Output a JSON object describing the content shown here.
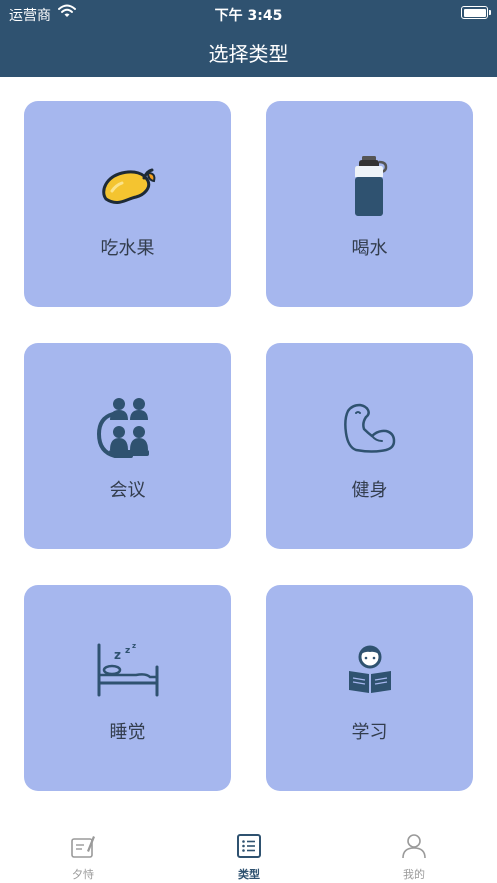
{
  "status_bar": {
    "carrier": "运营商",
    "time": "下午 3:45",
    "wifi_icon": "wifi-icon",
    "battery_icon": "battery-icon"
  },
  "nav": {
    "title": "选择类型"
  },
  "categories": [
    {
      "label": "吃水果",
      "icon": "mango-icon"
    },
    {
      "label": "喝水",
      "icon": "water-bottle-icon"
    },
    {
      "label": "会议",
      "icon": "meeting-people-icon"
    },
    {
      "label": "健身",
      "icon": "flexed-arm-icon"
    },
    {
      "label": "睡觉",
      "icon": "bed-sleep-icon"
    },
    {
      "label": "学习",
      "icon": "reading-person-icon"
    }
  ],
  "tabs": [
    {
      "label": "夕恃",
      "icon": "notebook-pen-icon",
      "active": false
    },
    {
      "label": "类型",
      "icon": "list-icon",
      "active": true
    },
    {
      "label": "我的",
      "icon": "user-icon",
      "active": false
    }
  ],
  "colors": {
    "header": "#2f5270",
    "card": "#a6b7ee",
    "accent": "#2f5270",
    "tab_inactive": "#9a9a9a"
  }
}
